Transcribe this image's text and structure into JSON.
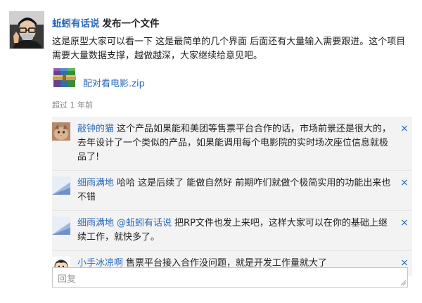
{
  "post": {
    "author": "蚯蚓有话说",
    "action": "发布一个文件",
    "body": "这是原型大家可以看一下 这是最简单的几个界面 后面还有大量输入需要跟进。这个项目需要大量数据支撑，越做越深，大家继续给意见吧。",
    "attachment": {
      "name": "配对看电影.zip",
      "icon": "winrar-archive-icon"
    },
    "timestamp": "超过 1 年前"
  },
  "comments": [
    {
      "author": "敲钟的猫",
      "mention": "",
      "text": "这个产品如果能和美团等售票平台合作的话，市场前景还是很大的，去年设计了一个类似的产品，如果能调用每个电影院的实时场次座位信息就极品了!",
      "avatar": "cat-photo-avatar"
    },
    {
      "author": "细雨满地",
      "mention": "",
      "text": "哈哈 这是后续了 能做自然好 前期咋们就做个极简实用的功能出来也不错",
      "avatar": "default-blue-avatar"
    },
    {
      "author": "细雨满地",
      "mention": "@蚯蚓有话说",
      "text": "把RP文件也发上来吧，这样大家可以在你的基础上继续工作，就快多了。",
      "avatar": "default-blue-avatar"
    },
    {
      "author": "小手冰凉啊",
      "mention": "",
      "text": "售票平台接入合作没问题，就是开发工作量就大了",
      "avatar": "cartoon-avatar"
    }
  ],
  "close_symbol": "×",
  "reply": {
    "placeholder": "回复",
    "value": ""
  },
  "colors": {
    "link": "#2a69b8",
    "comment_bg": "#f3f3f3",
    "muted": "#888888"
  }
}
